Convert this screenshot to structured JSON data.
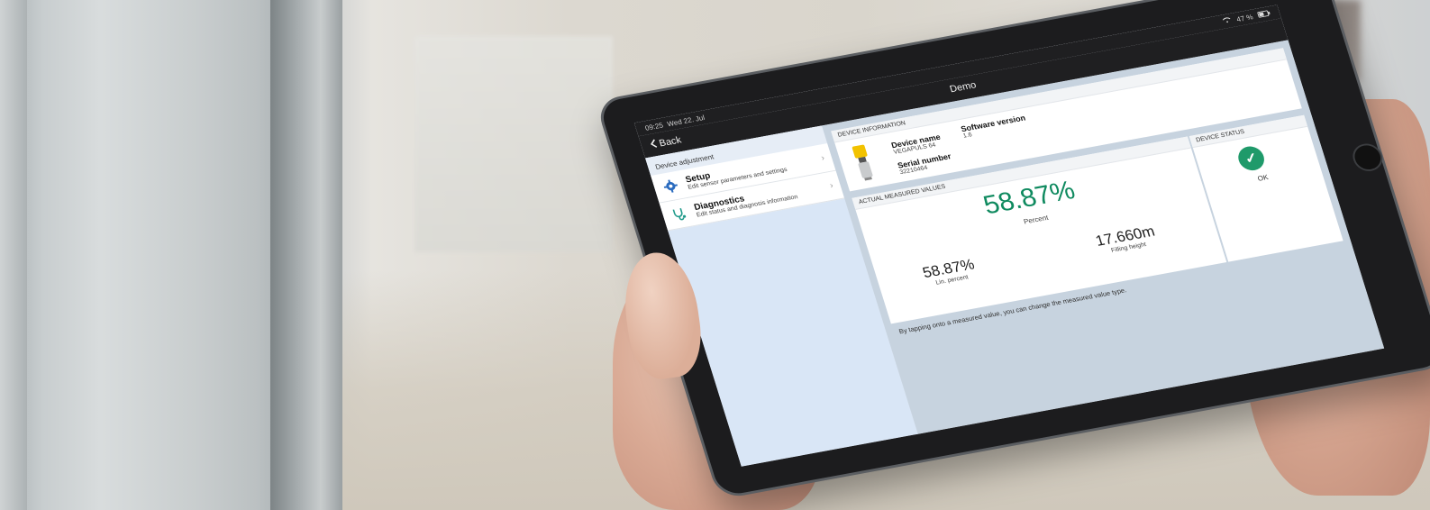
{
  "status_bar": {
    "time": "09:25",
    "date": "Wed 22. Jul",
    "battery": "47 %"
  },
  "nav": {
    "title": "Demo",
    "back_label": "Back"
  },
  "sidebar": {
    "section": "Device adjustment",
    "items": [
      {
        "title": "Setup",
        "subtitle": "Edit sensor parameters and settings",
        "icon": "gear-icon"
      },
      {
        "title": "Diagnostics",
        "subtitle": "Edit status and diagnosis information",
        "icon": "stethoscope-icon"
      }
    ]
  },
  "device_info": {
    "header": "DEVICE INFORMATION",
    "device_name_label": "Device name",
    "device_name_value": "VEGAPULS 64",
    "software_version_label": "Software version",
    "software_version_value": "1.6",
    "serial_number_label": "Serial number",
    "serial_number_value": "32210464"
  },
  "measured": {
    "header": "ACTUAL MEASURED VALUES",
    "primary_value": "58.87%",
    "primary_unit": "Percent",
    "secondary": [
      {
        "value": "58.87%",
        "unit": "Lin. percent"
      },
      {
        "value": "17.660m",
        "unit": "Filling height"
      }
    ],
    "hint": "By tapping onto a measured value, you can change the measured value type."
  },
  "device_status": {
    "header": "DEVICE STATUS",
    "label": "OK",
    "color": "#1f9a6a"
  }
}
